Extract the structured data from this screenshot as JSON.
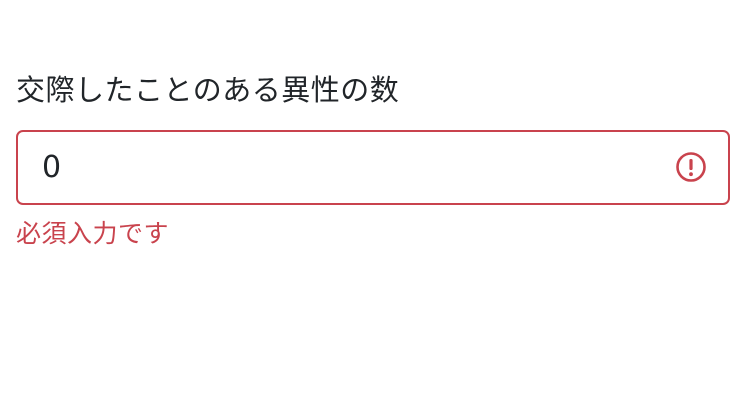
{
  "form": {
    "label": "交際したことのある異性の数",
    "input_value": "0",
    "error_icon": "exclamation-circle-icon",
    "error_message": "必須入力です",
    "error_color": "#c9434d"
  }
}
